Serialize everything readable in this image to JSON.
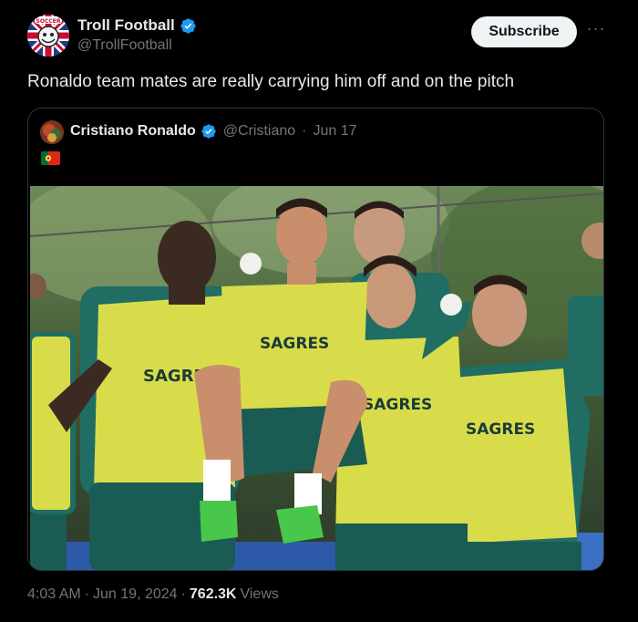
{
  "author": {
    "display_name": "Troll Football",
    "handle": "@TrollFootball",
    "avatar_icon": "troll-football-logo-icon",
    "verified": true
  },
  "actions": {
    "subscribe_label": "Subscribe",
    "more_icon": "more-dots-icon"
  },
  "tweet": {
    "text": "Ronaldo team mates are really carrying him off and on the pitch"
  },
  "quoted": {
    "display_name": "Cristiano Ronaldo",
    "handle": "@Cristiano",
    "separator": "·",
    "date": "Jun 17",
    "flag_icon": "portugal-flag-icon",
    "photo_icon": "team-training-photo",
    "photo_text": [
      "SAGRES",
      "SAGRES",
      "SAGRES",
      "SAGRES"
    ]
  },
  "meta": {
    "time": "4:03 AM",
    "dot1": "·",
    "date": "Jun 19, 2024",
    "dot2": "·",
    "views_count": "762.3K",
    "views_label": "Views"
  },
  "colors": {
    "background": "#000000",
    "text": "#e7e9ea",
    "muted": "#71767b",
    "verified_blue": "#1d9bf0",
    "bib_yellow": "#d9dc4a",
    "kit_teal": "#1f6d63"
  }
}
